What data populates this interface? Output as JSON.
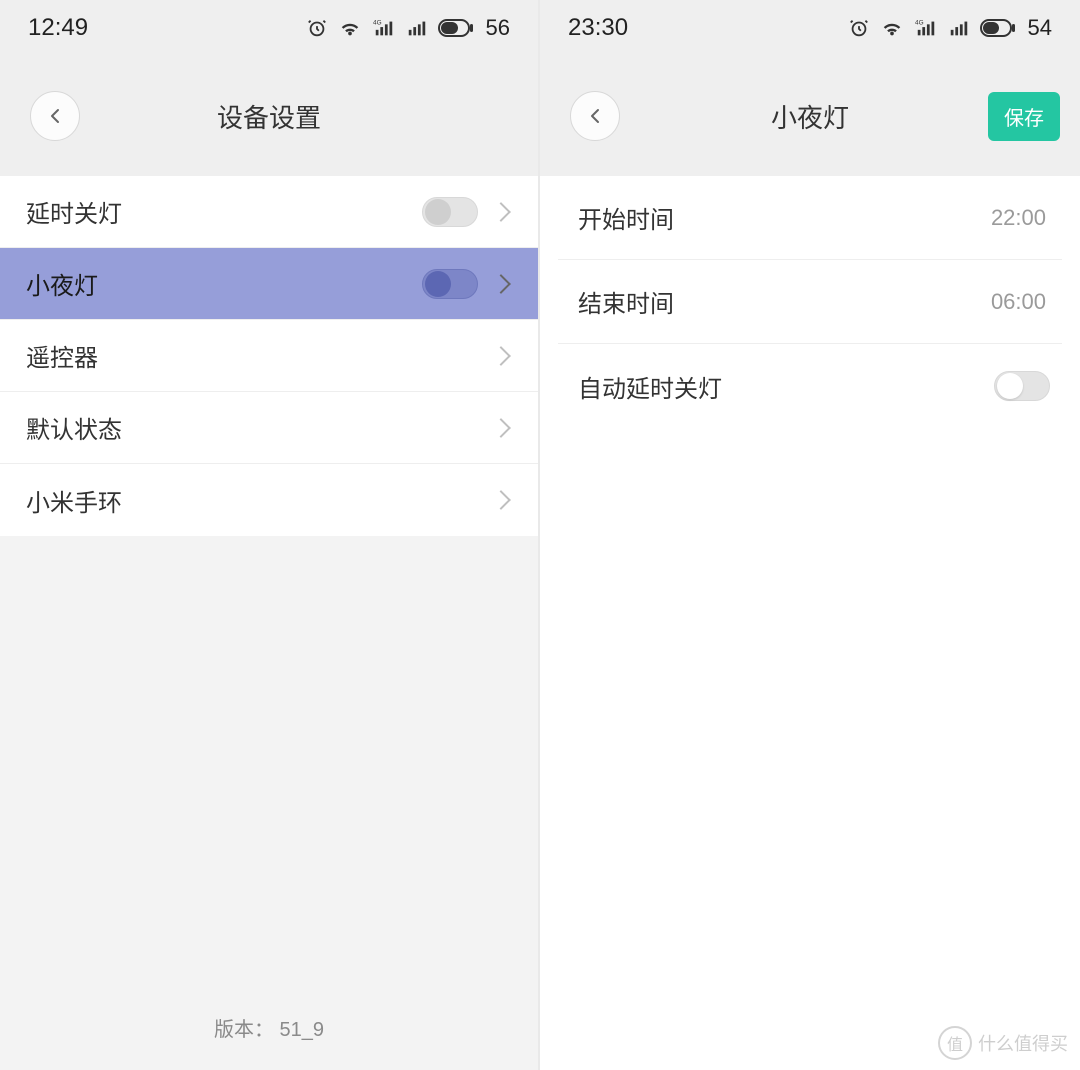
{
  "left": {
    "status": {
      "time": "12:49",
      "battery": "56"
    },
    "header": {
      "title": "设备设置"
    },
    "rows": {
      "delay_off": "延时关灯",
      "night_light": "小夜灯",
      "remote": "遥控器",
      "default_state": "默认状态",
      "mi_band": "小米手环"
    },
    "version": "版本： 51_9"
  },
  "right": {
    "status": {
      "time": "23:30",
      "battery": "54"
    },
    "header": {
      "title": "小夜灯",
      "save": "保存"
    },
    "rows": {
      "start_label": "开始时间",
      "start_value": "22:00",
      "end_label": "结束时间",
      "end_value": "06:00",
      "auto_delay_off": "自动延时关灯"
    }
  },
  "watermark": {
    "badge": "值",
    "text": "什么值得买"
  }
}
